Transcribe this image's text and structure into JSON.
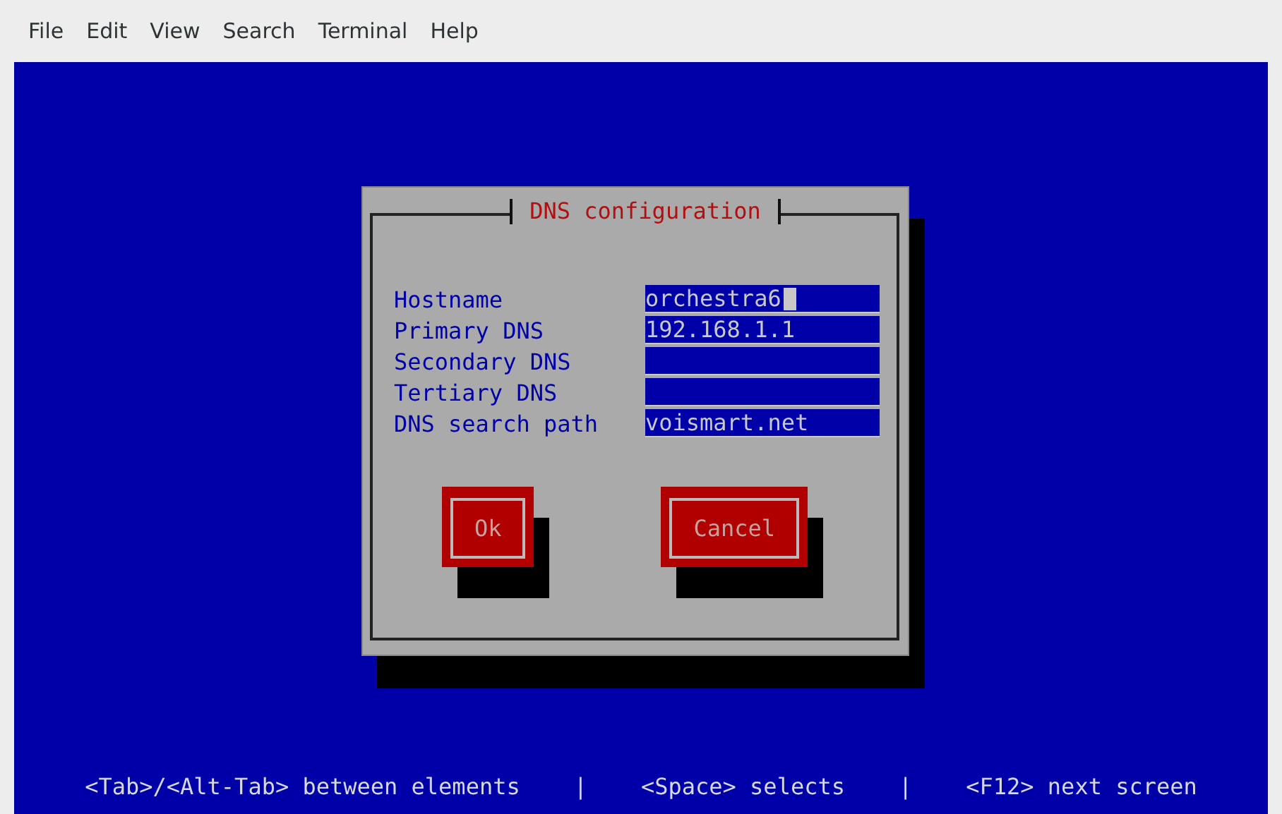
{
  "menu": [
    "File",
    "Edit",
    "View",
    "Search",
    "Terminal",
    "Help"
  ],
  "dialog": {
    "title": "DNS configuration",
    "fields": [
      {
        "label": "Hostname",
        "value": "orchestra6",
        "focused": true
      },
      {
        "label": "Primary DNS",
        "value": "192.168.1.1",
        "focused": false
      },
      {
        "label": "Secondary DNS",
        "focused": false
      },
      {
        "label": "Tertiary DNS",
        "focused": false
      },
      {
        "label": "DNS search path",
        "value": "voismart.net",
        "focused": false
      }
    ],
    "buttons": [
      "Ok",
      "Cancel"
    ]
  },
  "status_bar": {
    "hints": [
      "<Tab>/<Alt-Tab> between elements",
      "<Space> selects",
      "<F12> next screen"
    ],
    "separators": [
      "|",
      "|"
    ]
  }
}
